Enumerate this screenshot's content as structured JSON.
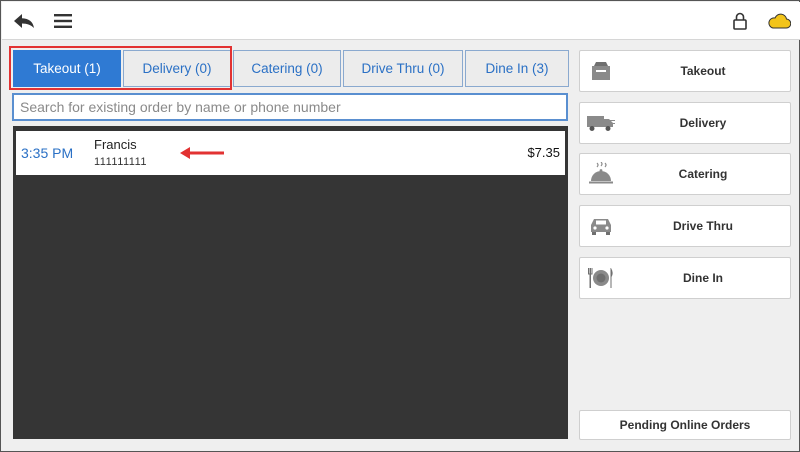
{
  "header": {
    "left_icons": [
      "back-arrow-icon",
      "hamburger-menu-icon"
    ],
    "right_icons": [
      "lock-icon",
      "cloud-icon"
    ],
    "colors": {
      "cloud": "#f2c41a",
      "lock": "#333333"
    }
  },
  "tabs": [
    {
      "label": "Takeout (1)",
      "active": true
    },
    {
      "label": "Delivery (0)",
      "active": false
    },
    {
      "label": "Catering (0)",
      "active": false
    },
    {
      "label": "Drive Thru (0)",
      "active": false
    },
    {
      "label": "Dine In (3)",
      "active": false
    }
  ],
  "search": {
    "placeholder": "Search for existing order by name or phone number",
    "value": ""
  },
  "orders": [
    {
      "time": "3:35 PM",
      "name": "Francis",
      "phone": "111111111",
      "total": "$7.35"
    }
  ],
  "sidebar": {
    "buttons": [
      {
        "label": "Takeout",
        "icon": "takeout-bag-icon"
      },
      {
        "label": "Delivery",
        "icon": "delivery-truck-icon"
      },
      {
        "label": "Catering",
        "icon": "cloche-icon"
      },
      {
        "label": "Drive Thru",
        "icon": "car-icon"
      },
      {
        "label": "Dine In",
        "icon": "plate-cutlery-icon"
      }
    ],
    "pending_label": "Pending Online Orders"
  },
  "colors": {
    "accent": "#2f7ad3",
    "annotation": "#e23232",
    "order_panel": "#353535"
  }
}
